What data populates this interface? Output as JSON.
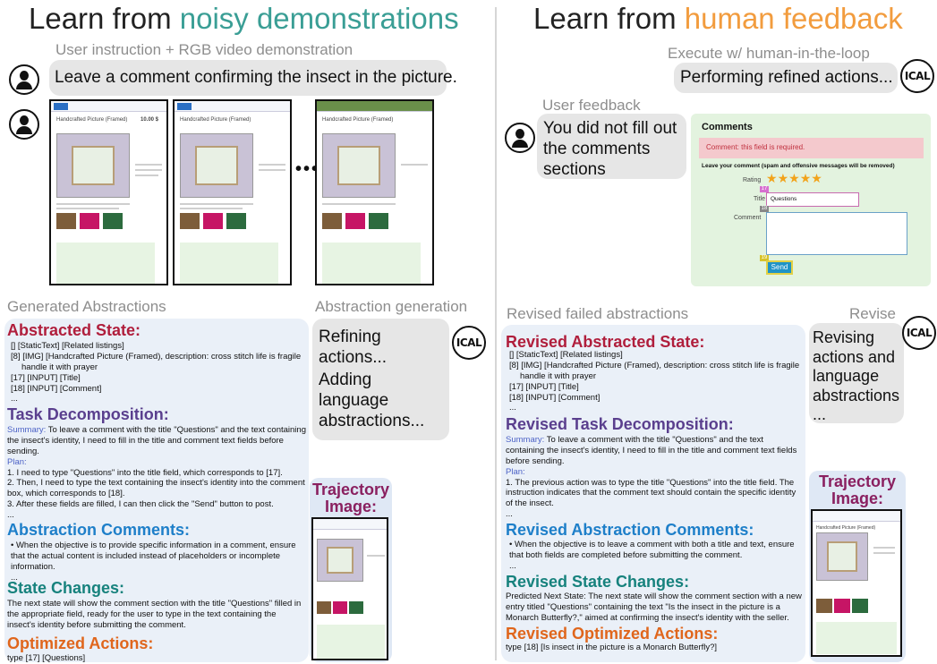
{
  "left": {
    "title_prefix": "Learn from ",
    "title_highlight": "noisy demonstrations",
    "caption_top": "User instruction + RGB video demonstration",
    "instruction": "Leave a comment confirming the insect in the picture.",
    "frame_title": "Handcrafted Picture (Framed)",
    "frame_price": "10.00 $",
    "ellipsis": "•••",
    "caption_abstractions": "Generated Abstractions",
    "caption_generation": "Abstraction generation",
    "generation_text_1": "Refining actions...",
    "generation_text_2": "Adding language abstractions...",
    "abstracted_state_title": "Abstracted State:",
    "abstracted_state_lines": [
      "[] [StaticText] [Related listings]",
      "[8] [IMG] [Handcrafted Picture (Framed), description: cross stitch life is fragile",
      "handle it with prayer",
      "[17] [INPUT] [Title]",
      "[18] [INPUT] [Comment]",
      "..."
    ],
    "task_title": "Task Decomposition:",
    "summary_label": "Summary:",
    "summary_text": "To leave a comment with the title \"Questions\" and the text containing the insect's identity, I need to fill in the title and comment text fields before sending.",
    "plan_label": "Plan:",
    "plan_items": [
      "1.   I need to type \"Questions\" into the title field, which corresponds to [17].",
      "2.   Then, I need to type the text containing the insect's identity into the comment box, which corresponds to [18].",
      "3.   After these fields are filled, I can then click the \"Send\" button to post."
    ],
    "plan_more": "...",
    "comments_title": "Abstraction Comments:",
    "comments_text": "• When the objective is to provide specific information in a comment, ensure that the actual content is included instead of placeholders or incomplete information.",
    "comments_more": "...",
    "state_changes_title": "State Changes:",
    "state_changes_text": "The next state will show the comment section with the title \"Questions\" filled in the appropriate field, ready for the user to type in the text containing the insect's identity before submitting the comment.",
    "optimized_title": "Optimized Actions:",
    "optimized_text": "type [17] [Questions]",
    "trajectory_title": "Trajectory Image:"
  },
  "right": {
    "title_prefix": "Learn from ",
    "title_highlight": "human feedback",
    "caption_execute": "Execute w/ human-in-the-loop",
    "performing": "Performing refined actions...",
    "caption_feedback": "User feedback",
    "feedback_text": "You did not fill out the comments sections",
    "form_title": "Comments",
    "form_error": "Comment: this field is required.",
    "form_prompt": "Leave your comment (spam and offensive messages will be removed)",
    "form_rating_label": "Rating",
    "form_title_label": "Title",
    "form_title_value": "Questions",
    "form_comment_label": "Comment",
    "form_send": "Send",
    "form_tag_1": "17",
    "form_tag_2": "18",
    "form_tag_3": "19",
    "caption_revised": "Revised failed abstractions",
    "caption_revise": "Revise",
    "revise_text": "Revising actions and language abstractions ...",
    "abstracted_state_title": "Revised Abstracted State:",
    "abstracted_state_lines": [
      "[] [StaticText] [Related listings]",
      "[8] [IMG] [Handcrafted Picture (Framed), description: cross stitch life is fragile",
      "handle it with prayer",
      "[17] [INPUT] [Title]",
      "[18] [INPUT] [Comment]",
      "..."
    ],
    "task_title": "Revised Task Decomposition:",
    "summary_label": "Summary:",
    "summary_text": "To leave a comment with the title \"Questions\" and the text containing the insect's identity, I need to fill in the title and comment text fields before sending.",
    "plan_label": "Plan:",
    "plan_items": [
      "1.   The previous action was to type the title \"Questions\" into the title field. The instruction indicates that the comment text should contain the specific identity of the insect."
    ],
    "plan_more": "...",
    "comments_title": "Revised Abstraction Comments:",
    "comments_text": "• When the objective is to leave a comment with both a title and text, ensure that both fields are completed before submitting the comment.",
    "comments_more": "...",
    "state_changes_title": "Revised State Changes:",
    "state_changes_text": "Predicted Next State: The next state will show the comment section with a new entry titled \"Questions\" containing the text \"Is the insect in the picture is a Monarch Butterfly?,\" aimed at confirming the insect's identity with the seller.",
    "optimized_title": "Revised Optimized Actions:",
    "optimized_text": "type [18] [Is insect in the picture is a Monarch Butterfly?]",
    "trajectory_title": "Trajectory Image:"
  },
  "icons": {
    "user": "user-icon",
    "ical": "ICAL"
  },
  "colors": {
    "teal_highlight": "#3a9e95",
    "orange_highlight": "#f29c3e",
    "red_title": "#b01e3c",
    "purple_title": "#5a3f8e",
    "blue_title": "#1e7fc9",
    "teal_title": "#17827d",
    "orange_title": "#e0661c"
  }
}
